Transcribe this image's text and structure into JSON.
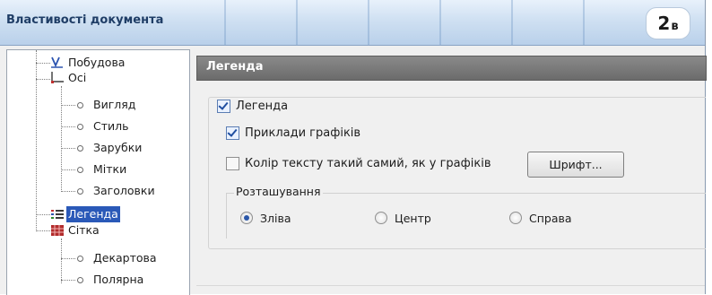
{
  "window": {
    "title": "Властивості документа",
    "badge_number": "2",
    "badge_letter": "в"
  },
  "tree": {
    "items": [
      {
        "label": "Побудова",
        "icon": "chart-line-icon"
      },
      {
        "label": "Осі",
        "icon": "axes-icon"
      },
      {
        "label": "Вигляд",
        "icon": "node-circle-icon"
      },
      {
        "label": "Стиль",
        "icon": "node-circle-icon"
      },
      {
        "label": "Зарубки",
        "icon": "node-circle-icon"
      },
      {
        "label": "Мітки",
        "icon": "node-circle-icon"
      },
      {
        "label": "Заголовки",
        "icon": "node-circle-icon"
      },
      {
        "label": "Легенда",
        "icon": "legend-list-icon",
        "selected": true
      },
      {
        "label": "Сітка",
        "icon": "grid-icon"
      },
      {
        "label": "Декартова",
        "icon": "node-circle-icon"
      },
      {
        "label": "Полярна",
        "icon": "node-circle-icon"
      }
    ]
  },
  "panel": {
    "header": "Легенда",
    "legend_checkbox": {
      "label": "Легенда",
      "checked": true
    },
    "samples_checkbox": {
      "label": "Приклади графіків",
      "checked": true
    },
    "text_color_checkbox": {
      "label": "Колір тексту такий самий, як у графіків",
      "checked": false
    },
    "font_button": "Шрифт...",
    "position": {
      "label": "Розташування",
      "options": [
        {
          "label": "Зліва",
          "checked": true
        },
        {
          "label": "Центр",
          "checked": false
        },
        {
          "label": "Справа",
          "checked": false
        }
      ]
    }
  },
  "colors": {
    "selection": "#2a59b8",
    "header": "#6b6b6b",
    "title_text": "#1f3d66"
  }
}
